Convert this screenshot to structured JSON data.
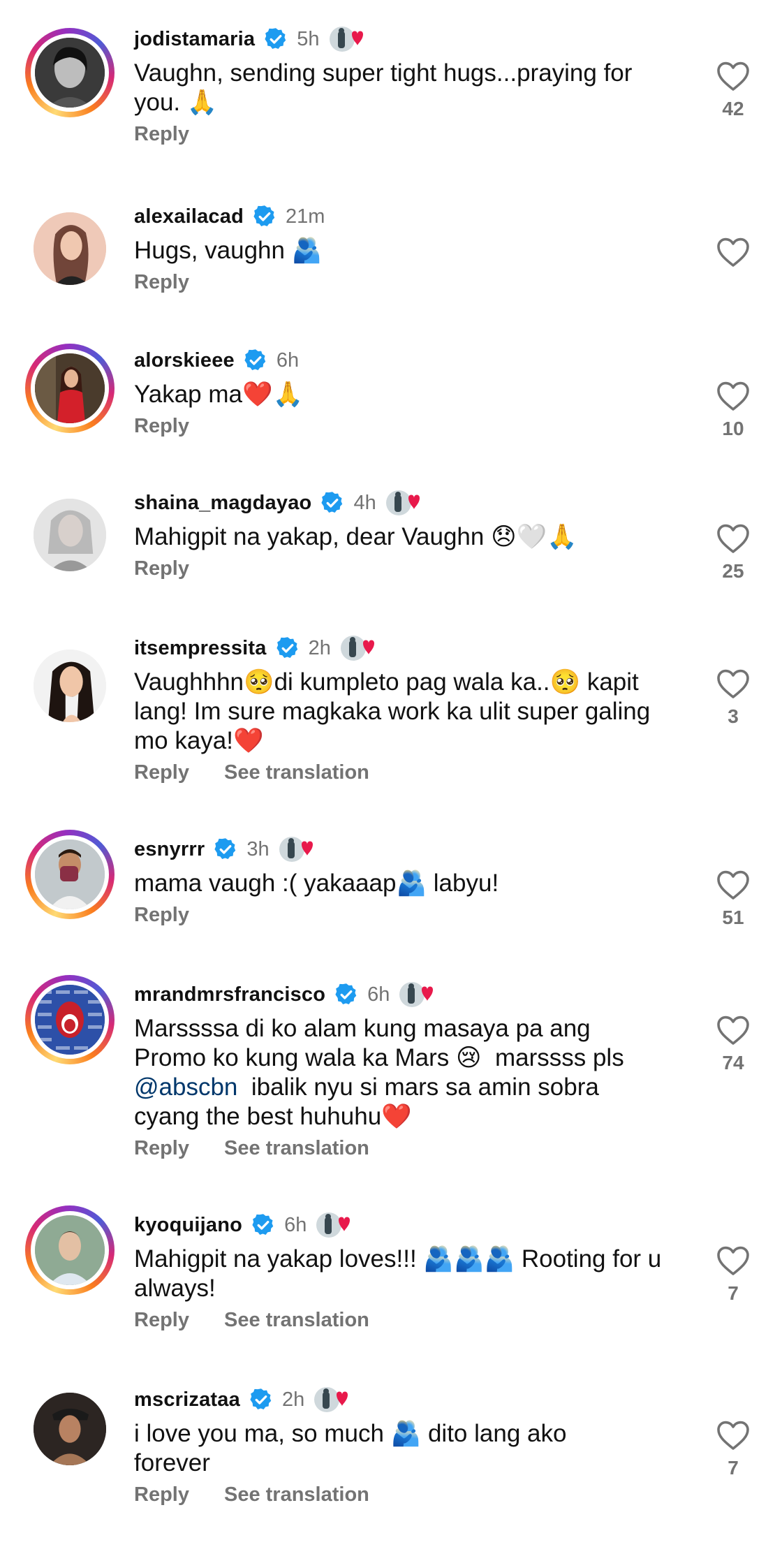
{
  "comments": [
    {
      "username": "jodistamaria",
      "time": "5h",
      "text": "Vaughn, sending super tight hugs...praying for you. 🙏",
      "reply": "Reply",
      "likes": "42",
      "story": true,
      "hasStoryIcon": true
    },
    {
      "username": "alexailacad",
      "time": "21m",
      "text": "Hugs, vaughn 🫂",
      "reply": "Reply",
      "likes": "",
      "story": false,
      "hasStoryIcon": false
    },
    {
      "username": "alorskieee",
      "time": "6h",
      "text": "Yakap ma❤️🙏",
      "reply": "Reply",
      "likes": "10",
      "story": true,
      "hasStoryIcon": false
    },
    {
      "username": "shaina_magdayao",
      "time": "4h",
      "text": "Mahigpit na yakap, dear Vaughn 😞🤍🙏",
      "reply": "Reply",
      "likes": "25",
      "story": false,
      "hasStoryIcon": true
    },
    {
      "username": "itsempressita",
      "time": "2h",
      "text": "Vaughhhn🥺di kumpleto pag wala ka..🥺 kapit lang! Im sure magkaka work ka ulit super galing mo kaya!❤️",
      "reply": "Reply",
      "translate": "See translation",
      "likes": "3",
      "story": false,
      "hasStoryIcon": true
    },
    {
      "username": "esnyrrr",
      "time": "3h",
      "text": "mama vaugh :( yakaaap🫂 labyu!",
      "reply": "Reply",
      "likes": "51",
      "story": true,
      "hasStoryIcon": true
    },
    {
      "username": "mrandmrsfrancisco",
      "time": "6h",
      "text_parts": [
        "Marssssa di ko alam kung masaya pa ang Promo ko kung wala ka Mars 😢  marssss pls ",
        "@abscbn",
        "  ibalik nyu si mars sa amin sobra cyang the best huhuhu❤️"
      ],
      "reply": "Reply",
      "translate": "See translation",
      "likes": "74",
      "story": true,
      "hasStoryIcon": true
    },
    {
      "username": "kyoquijano",
      "time": "6h",
      "text": "Mahigpit na yakap loves!!! 🫂🫂🫂 Rooting for u always!",
      "reply": "Reply",
      "translate": "See translation",
      "likes": "7",
      "story": true,
      "hasStoryIcon": true
    },
    {
      "username": "mscrizataa",
      "time": "2h",
      "text": "i love you ma, so much 🫂 dito lang ako forever",
      "reply": "Reply",
      "translate": "See translation",
      "likes": "7",
      "story": false,
      "hasStoryIcon": true
    }
  ],
  "colors": {
    "verified": "#1d9bf0",
    "meta_gray": "#737373",
    "mention": "#00376b"
  },
  "icons": {
    "verified": "verified-badge-icon",
    "like": "heart-outline-icon",
    "story": "story-thumbnail-icon"
  }
}
